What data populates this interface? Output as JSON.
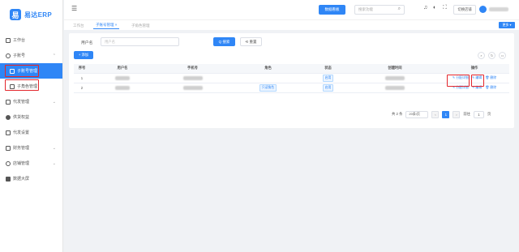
{
  "app": {
    "logo_mark": "易",
    "logo_text": "易达ERP"
  },
  "sidebar": {
    "items": [
      {
        "label": "工作台"
      },
      {
        "label": "子账号"
      },
      {
        "label": "子账号管理"
      },
      {
        "label": "子角色管理"
      },
      {
        "label": "代发管理"
      },
      {
        "label": "供货权益"
      },
      {
        "label": "代发设置"
      },
      {
        "label": "财务管理"
      },
      {
        "label": "店铺管理"
      },
      {
        "label": "数据大屏"
      }
    ]
  },
  "topbar": {
    "screen_btn": "数据看板",
    "search_placeholder": "搜索功能",
    "switch_btn": "切换店铺"
  },
  "tabs": [
    {
      "label": "工作台"
    },
    {
      "label": "子账号管理 ×"
    },
    {
      "label": "子角色管理"
    }
  ],
  "tabs_more": "更多 ▾",
  "filter": {
    "label": "用户名",
    "placeholder": "用户名",
    "search_btn": "Q 搜索",
    "reset_btn": "⟲ 重置"
  },
  "toolbar": {
    "add_btn": "+ 添加"
  },
  "table": {
    "headers": [
      "序号",
      "用户名",
      "手机号",
      "角色",
      "状态",
      "创建时间",
      "操作"
    ],
    "rows": [
      {
        "index": "1",
        "role": "",
        "status": "启用"
      },
      {
        "index": "2",
        "role": "只读角色",
        "status": "启用"
      }
    ],
    "ops": {
      "assign": "✎ 分配详细",
      "edit": "✎ 编辑",
      "delete": "🗑 删除"
    }
  },
  "pagination": {
    "total": "共 2 条",
    "page_size": "20条/页",
    "prev": "<",
    "current": "1",
    "next": ">",
    "goto_label": "前往",
    "goto_value": "1",
    "page_suffix": "页"
  },
  "colors": {
    "primary": "#2f86f6",
    "highlight_box": "#e3262c"
  }
}
